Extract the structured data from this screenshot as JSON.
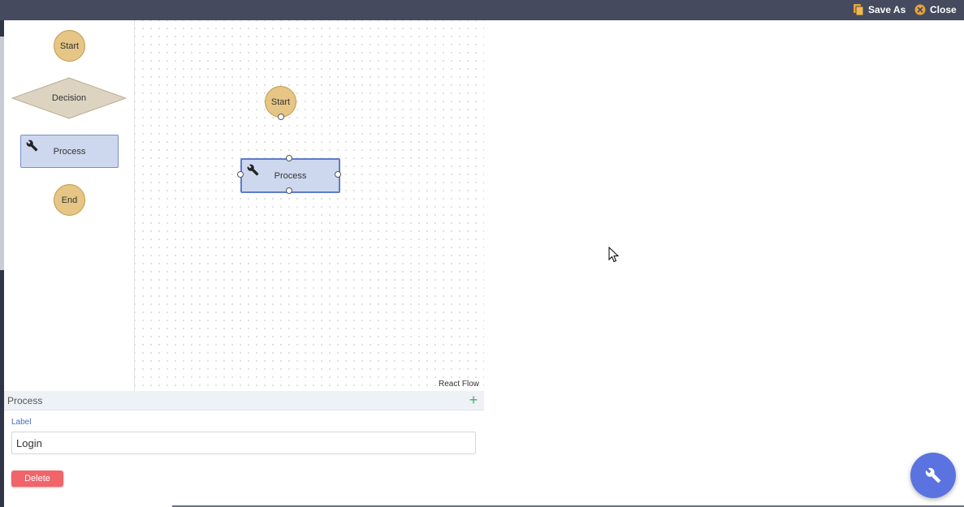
{
  "topbar": {
    "save_as_label": "Save As",
    "close_label": "Close",
    "icons": {
      "save_as": "save-as-icon",
      "close": "close-circle-icon"
    },
    "colors": {
      "background": "#454a5e",
      "save_icon": "#e8a33a",
      "close_icon": "#e8a33a"
    }
  },
  "palette": {
    "start_label": "Start",
    "decision_label": "Decision",
    "process_label": "Process",
    "end_label": "End"
  },
  "canvas": {
    "start_node_label": "Start",
    "process_node_label": "Process",
    "attribution": "React Flow"
  },
  "properties": {
    "title": "Process",
    "label_field_label": "Label",
    "label_value": "Login",
    "delete_label": "Delete"
  },
  "fab": {
    "icon": "wrench-icon",
    "color": "#5a73e0"
  },
  "colors": {
    "circle_node": "#e6c585",
    "decision_node": "#dcd3c0",
    "process_node": "#cdd8ee",
    "selected_border": "#5d7cc9",
    "delete_button": "#f0646a",
    "add_icon": "#3cb55a"
  }
}
